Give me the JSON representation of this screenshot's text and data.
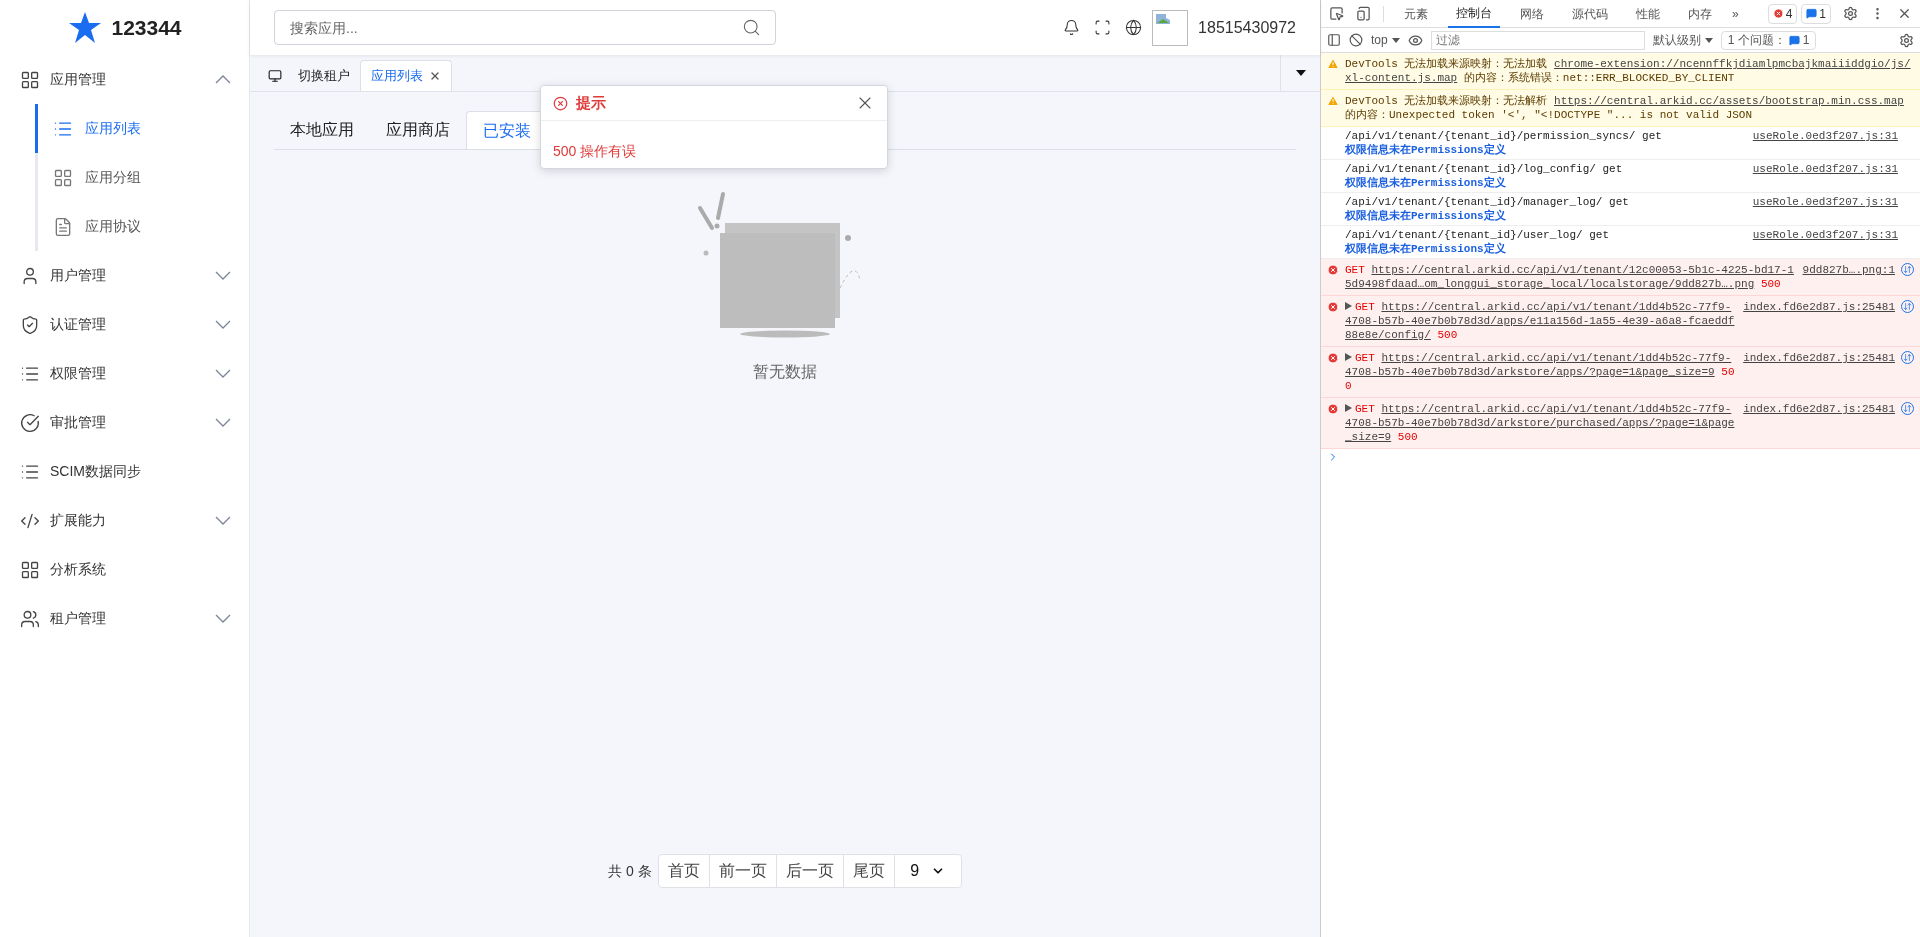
{
  "brand": {
    "name": "123344"
  },
  "sidebar": {
    "items": [
      {
        "label": "应用管理",
        "kind": "group",
        "expanded": true,
        "children": [
          {
            "label": "应用列表",
            "selected": true
          },
          {
            "label": "应用分组",
            "selected": false
          },
          {
            "label": "应用协议",
            "selected": false
          }
        ]
      },
      {
        "label": "用户管理",
        "kind": "group",
        "expanded": false
      },
      {
        "label": "认证管理",
        "kind": "group",
        "expanded": false
      },
      {
        "label": "权限管理",
        "kind": "group",
        "expanded": false
      },
      {
        "label": "审批管理",
        "kind": "group",
        "expanded": false
      },
      {
        "label": "SCIM数据同步",
        "kind": "link"
      },
      {
        "label": "扩展能力",
        "kind": "group",
        "expanded": false
      },
      {
        "label": "分析系统",
        "kind": "link"
      },
      {
        "label": "租户管理",
        "kind": "group",
        "expanded": false
      }
    ]
  },
  "header": {
    "search": {
      "placeholder": "搜索应用..."
    },
    "user": "18515430972"
  },
  "page_tabs": [
    {
      "label": "切换租户",
      "kind": "switch",
      "selected": false
    },
    {
      "label": "应用列表",
      "kind": "page",
      "selected": true
    }
  ],
  "content_tabs": [
    {
      "label": "本地应用",
      "selected": false
    },
    {
      "label": "应用商店",
      "selected": false
    },
    {
      "label": "已安装",
      "selected": true
    }
  ],
  "empty": {
    "text": "暂无数据"
  },
  "pagination": {
    "total": "共 0 条",
    "buttons": [
      "首页",
      "前一页",
      "后一页",
      "尾页"
    ],
    "page_size": "9"
  },
  "dialog": {
    "title": "提示",
    "message": "500 操作有误"
  },
  "devtools": {
    "tabs": [
      {
        "label": "元素",
        "selected": false
      },
      {
        "label": "控制台",
        "selected": true
      },
      {
        "label": "网络",
        "selected": false
      },
      {
        "label": "源代码",
        "selected": false
      },
      {
        "label": "性能",
        "selected": false
      },
      {
        "label": "内存",
        "selected": false
      }
    ],
    "more": "»",
    "error_count": "4",
    "message_count": "1",
    "context": "top",
    "filter_placeholder": "过滤",
    "level": "默认级别",
    "issues_label": "1 个问题：",
    "issues_count": "1",
    "messages": [
      {
        "kind": "warning",
        "prefix": "DevTools 无法加载来源映射：无法加载",
        "link": "chrome-extension://ncennffkjdiamlpmcbajkmaiiiddgio/js/xl-content.js.map",
        "suffix": "的内容：系统错误：net::ERR_BLOCKED_BY_CLIENT"
      },
      {
        "kind": "warning",
        "prefix": "DevTools 无法加载来源映射：无法解析",
        "link": "https://central.arkid.cc/assets/bootstrap.min.css.map",
        "suffix": "的内容：Unexpected token '<', \"<!DOCTYPE \"... is not valid JSON"
      },
      {
        "kind": "log",
        "text": "/api/v1/tenant/{tenant_id}/permission_syncs/ get",
        "subtext": "权限信息未在Permissions定义",
        "source": "useRole.0ed3f207.js:31"
      },
      {
        "kind": "log",
        "text": "/api/v1/tenant/{tenant_id}/log_config/ get",
        "subtext": "权限信息未在Permissions定义",
        "source": "useRole.0ed3f207.js:31"
      },
      {
        "kind": "log",
        "text": "/api/v1/tenant/{tenant_id}/manager_log/ get",
        "subtext": "权限信息未在Permissions定义",
        "source": "useRole.0ed3f207.js:31"
      },
      {
        "kind": "log",
        "text": "/api/v1/tenant/{tenant_id}/user_log/ get",
        "subtext": "权限信息未在Permissions定义",
        "source": "useRole.0ed3f207.js:31"
      },
      {
        "kind": "error",
        "expandable": false,
        "method": "GET",
        "url": "https://central.arkid.cc/api/v1/tenant/12c00053-5b1c-4225-bd17-15d9498fdaad…om_longgui_storage_local/localstorage/9dd827b….png",
        "status": "500",
        "source": "9dd827b….png:1"
      },
      {
        "kind": "error",
        "expandable": true,
        "method": "GET",
        "url": "https://central.arkid.cc/api/v1/tenant/1dd4b52c-77f9-4708-b57b-40e7b0b78d3d/apps/e11a156d-1a55-4e39-a6a8-fcaeddf88e8e/config/",
        "status": "500",
        "source": "index.fd6e2d87.js:25481"
      },
      {
        "kind": "error",
        "expandable": true,
        "method": "GET",
        "url": "https://central.arkid.cc/api/v1/tenant/1dd4b52c-77f9-4708-b57b-40e7b0b78d3d/arkstore/apps/?page=1&page_size=9",
        "status": "500",
        "source": "index.fd6e2d87.js:25481"
      },
      {
        "kind": "error",
        "expandable": true,
        "method": "GET",
        "url": "https://central.arkid.cc/api/v1/tenant/1dd4b52c-77f9-4708-b57b-40e7b0b78d3d/arkstore/purchased/apps/?page=1&page_size=9",
        "status": "500",
        "source": "index.fd6e2d87.js:25481"
      }
    ]
  }
}
